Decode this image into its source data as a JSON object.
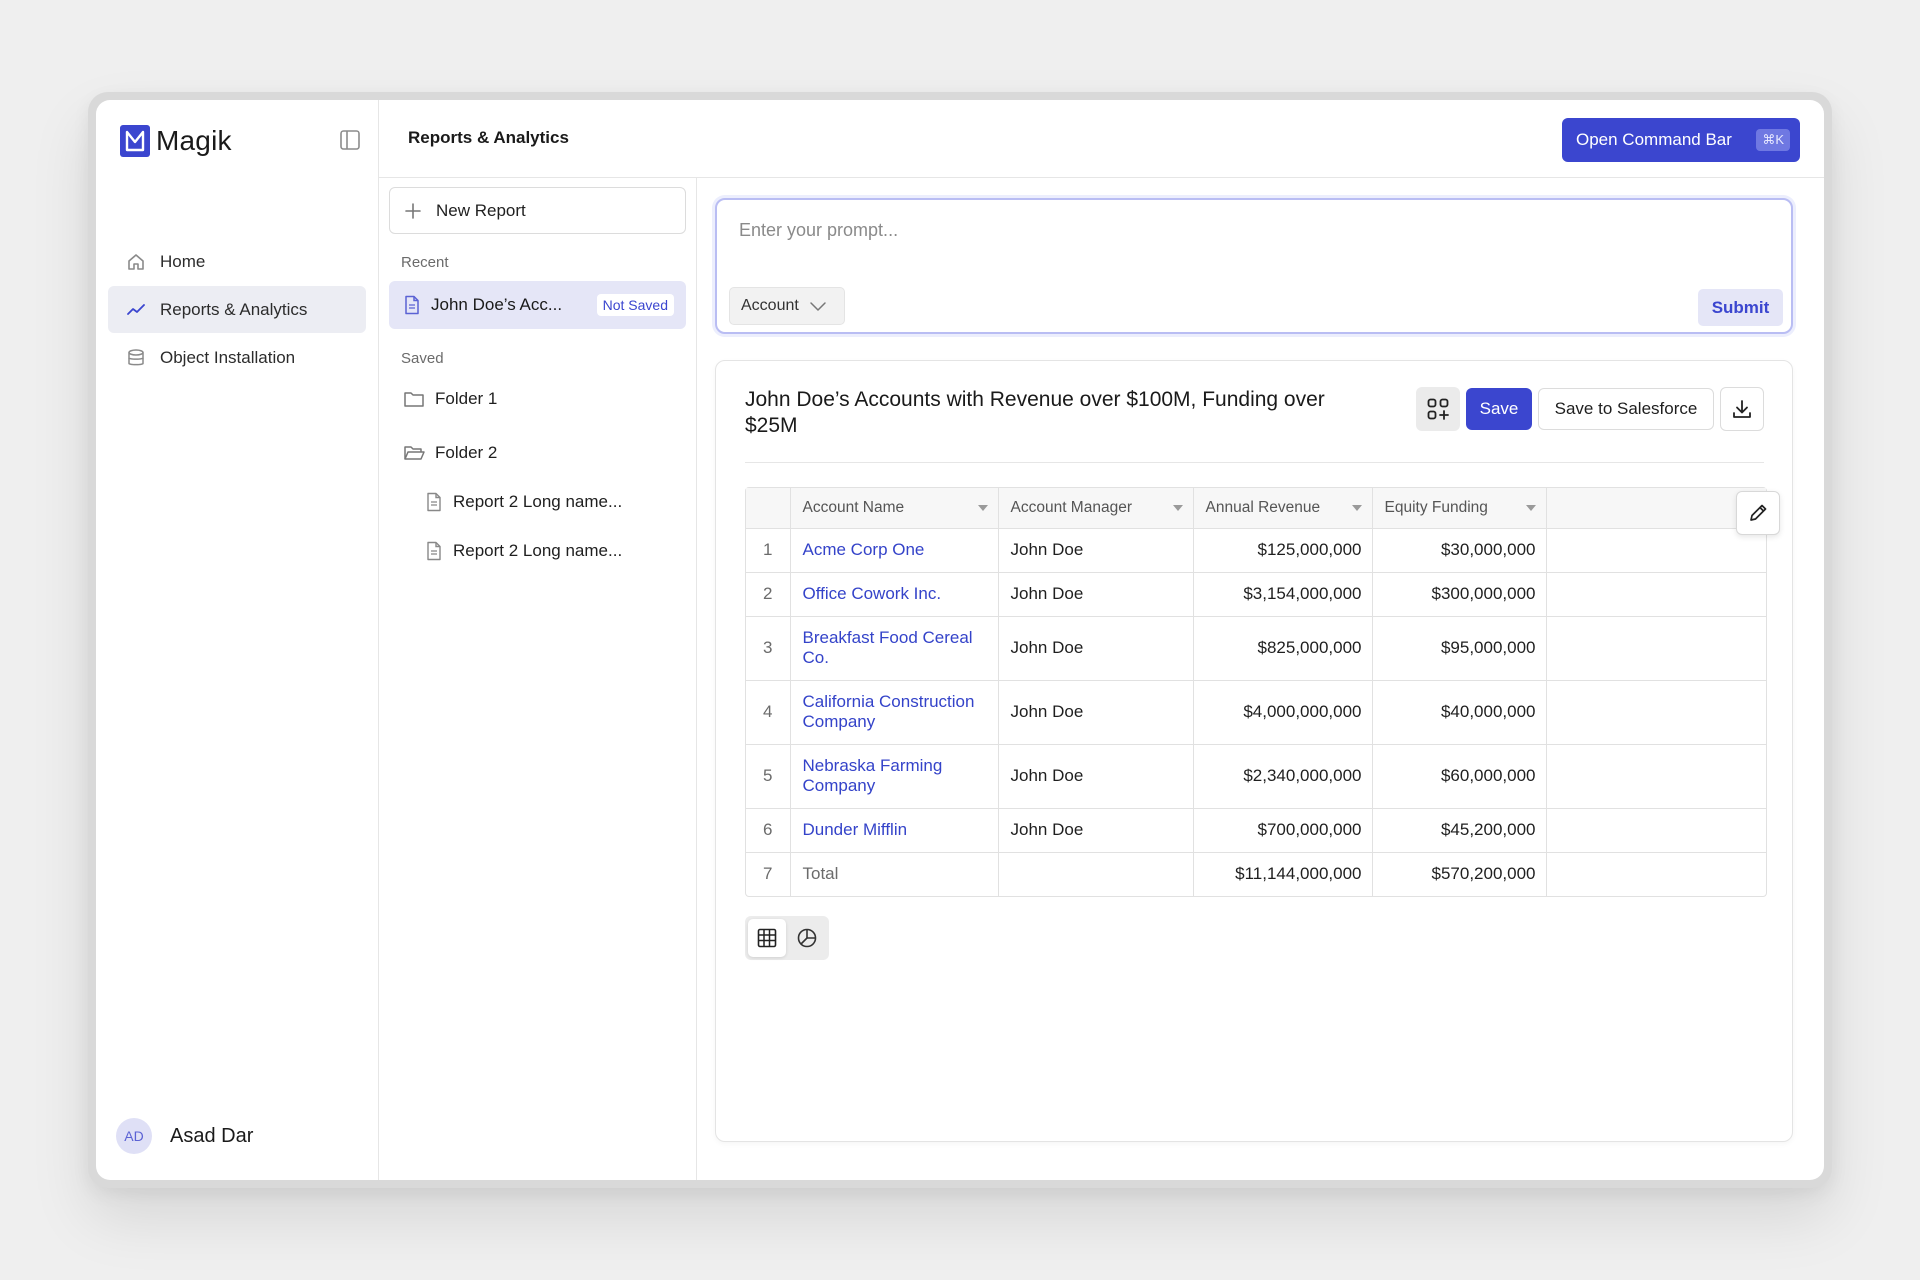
{
  "app": {
    "name": "Magik",
    "page_title": "Reports & Analytics",
    "command_button_label": "Open Command Bar",
    "command_shortcut": "⌘K",
    "accent_color": "#3b46cf"
  },
  "sidebar": {
    "items": [
      {
        "label": "Home",
        "icon": "home-icon",
        "active": false
      },
      {
        "label": "Reports & Analytics",
        "icon": "trend-line-icon",
        "active": true
      },
      {
        "label": "Object Installation",
        "icon": "database-icon",
        "active": false
      }
    ],
    "user": {
      "initials": "AD",
      "name": "Asad Dar"
    }
  },
  "reports_panel": {
    "new_report_label": "New Report",
    "recent_label": "Recent",
    "recent_item": {
      "name": "John Doe’s Acc...",
      "badge": "Not Saved"
    },
    "saved_label": "Saved",
    "folders": [
      {
        "name": "Folder 1",
        "open": false,
        "children": []
      },
      {
        "name": "Folder 2",
        "open": true,
        "children": [
          "Report 2 Long name...",
          "Report 2 Long name..."
        ]
      }
    ]
  },
  "prompt": {
    "placeholder": "Enter your prompt...",
    "object_selected": "Account",
    "submit_label": "Submit"
  },
  "report": {
    "title": "John Doe’s Accounts with Revenue over $100M, Funding over $25M",
    "save_label": "Save",
    "save_sf_label": "Save to Salesforce",
    "columns": [
      "Account Name",
      "Account Manager",
      "Annual Revenue",
      "Equity Funding"
    ],
    "rows": [
      {
        "idx": "1",
        "name": "Acme Corp One",
        "manager": "John Doe",
        "revenue": "$125,000,000",
        "funding": "$30,000,000"
      },
      {
        "idx": "2",
        "name": "Office Cowork Inc.",
        "manager": "John Doe",
        "revenue": "$3,154,000,000",
        "funding": "$300,000,000"
      },
      {
        "idx": "3",
        "name": "Breakfast Food Cereal Co.",
        "manager": "John Doe",
        "revenue": "$825,000,000",
        "funding": "$95,000,000"
      },
      {
        "idx": "4",
        "name": "California Construction Company",
        "manager": "John Doe",
        "revenue": "$4,000,000,000",
        "funding": "$40,000,000"
      },
      {
        "idx": "5",
        "name": "Nebraska Farming Company",
        "manager": "John Doe",
        "revenue": "$2,340,000,000",
        "funding": "$60,000,000"
      },
      {
        "idx": "6",
        "name": "Dunder Mifflin",
        "manager": "John Doe",
        "revenue": "$700,000,000",
        "funding": "$45,200,000"
      }
    ],
    "total": {
      "idx": "7",
      "label": "Total",
      "revenue": "$11,144,000,000",
      "funding": "$570,200,000"
    },
    "view_modes": [
      "table-view",
      "chart-view"
    ],
    "active_view": "table-view"
  }
}
